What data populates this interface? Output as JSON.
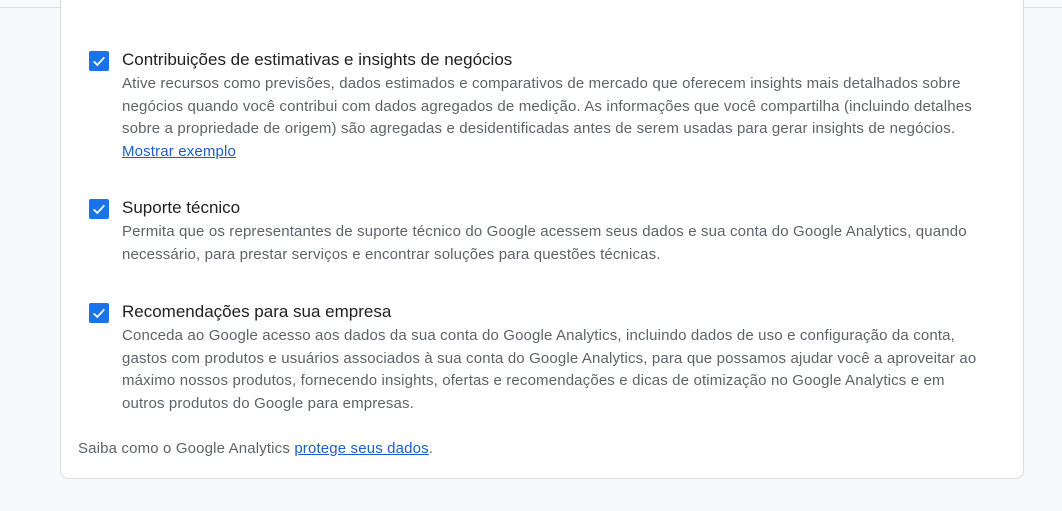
{
  "options": [
    {
      "checked": true,
      "title": "Contribuições de estimativas e insights de negócios",
      "description": "Ative recursos como previsões, dados estimados e comparativos de mercado que oferecem insights mais detalhados sobre negócios quando você contribui com dados agregados de medição. As informações que você compartilha (incluindo detalhes sobre a propriedade de origem) são agregadas e desidentificadas antes de serem usadas para gerar insights de negócios.",
      "link_label": "Mostrar exemplo"
    },
    {
      "checked": true,
      "title": "Suporte técnico",
      "description": "Permita que os representantes de suporte técnico do Google acessem seus dados e sua conta do Google Analytics, quando necessário, para prestar serviços e encontrar soluções para questões técnicas."
    },
    {
      "checked": true,
      "title": "Recomendações para sua empresa",
      "description": "Conceda ao Google acesso aos dados da sua conta do Google Analytics, incluindo dados de uso e configuração da conta, gastos com produtos e usuários associados à sua conta do Google Analytics, para que possamos ajudar você a aproveitar ao máximo nossos produtos, fornecendo insights, ofertas e recomendações e dicas de otimização no Google Analytics e em outros produtos do Google para empresas."
    }
  ],
  "footer": {
    "prefix": "Saiba como o Google Analytics",
    "link_label": "protege seus dados",
    "suffix": "."
  },
  "colors": {
    "checkbox": "#1a73e8",
    "link": "#1a5fc7",
    "text_secondary": "#5f6368",
    "text_primary": "#202124"
  },
  "icons": {
    "checkbox": "check-icon"
  }
}
